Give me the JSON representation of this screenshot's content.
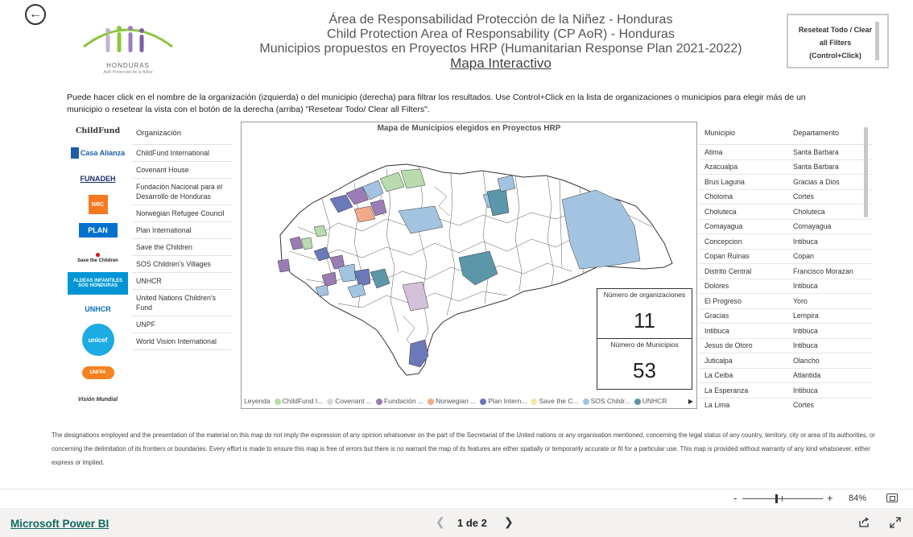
{
  "header": {
    "title_line1": "Área de Responsabilidad Protección de la Niñez - Honduras",
    "title_line2": "Child Protection Area of Responsability (CP AoR) - Honduras",
    "title_line3": "Municipios propuestos en Proyectos HRP (Humanitarian Response Plan 2021-2022)",
    "title_link": "Mapa Interactivo",
    "logo_name": "HONDURAS",
    "logo_subtitle": "AoR Protección de la Niñez",
    "reset_button": "Reseteat Todo / Clear all Filters (Control+Click)"
  },
  "instructions": "Puede hacer click en el nombre de la organización (izquierda) o del municipio (derecha) para filtrar los resultados. Use Control+Click en la lista de organizaciones o municipios para elegir más de un municipio o resetear la vista con el botón de la derecha (arriba) \"Resetear Todo/ Clear all Filters\".",
  "org_logos": [
    {
      "name": "ChildFund",
      "color": "#1a1a1a"
    },
    {
      "name": "Casa Alianza",
      "color": "#1a5fa8"
    },
    {
      "name": "FUNADEH",
      "color": "#1b2f6b"
    },
    {
      "name": "NRC",
      "color": "#f47920"
    },
    {
      "name": "PLAN",
      "color": "#0072ce"
    },
    {
      "name": "Save the Children",
      "color": "#d71920"
    },
    {
      "name": "ALDEAS INFANTILES SOS HONDURAS",
      "color": "#0096d6"
    },
    {
      "name": "UNHCR",
      "color": "#0072bc"
    },
    {
      "name": "unicef",
      "color": "#1cabe2"
    },
    {
      "name": "UNFPA",
      "color": "#f58220"
    },
    {
      "name": "Visión Mundial",
      "color": "#333333"
    }
  ],
  "organizations": {
    "header": "Organización",
    "items": [
      "ChildFund International",
      "Covenant House",
      "Fundación Nacional para el Desarrollo de Honduras",
      "Norwegian Refugee Council",
      "Plan International",
      "Save the Children",
      "SOS Children's Villages",
      "UNHCR",
      "United Nations Children's Fund",
      "UNPF",
      "World Vision International"
    ]
  },
  "map": {
    "title": "Mapa de Municipios elegidos en Proyectos HRP",
    "legend_label": "Leyenda",
    "legend": [
      {
        "name": "ChildFund I...",
        "color": "#b8dcae"
      },
      {
        "name": "Covenant ...",
        "color": "#d9d9d9"
      },
      {
        "name": "Fundación ...",
        "color": "#9a7db5"
      },
      {
        "name": "Norwegian ...",
        "color": "#f2a98a"
      },
      {
        "name": "Plan Intern...",
        "color": "#6b79b8"
      },
      {
        "name": "Save the C...",
        "color": "#f5e6a3"
      },
      {
        "name": "SOS Childr...",
        "color": "#a3c4e0"
      },
      {
        "name": "UNHCR",
        "color": "#5b97a8"
      }
    ]
  },
  "kpis": {
    "orgs_label": "Número de organizaciones",
    "orgs_value": "11",
    "munis_label": "Número de Municipios",
    "munis_value": "53"
  },
  "municipios": {
    "header_muni": "Municipio",
    "header_dept": "Departamento",
    "rows": [
      [
        "Atima",
        "Santa Barbara"
      ],
      [
        "Azacualpa",
        "Santa Barbara"
      ],
      [
        "Brus Laguna",
        "Gracias a Dios"
      ],
      [
        "Choloma",
        "Cortes"
      ],
      [
        "Choluteca",
        "Choluteca"
      ],
      [
        "Comayagua",
        "Comayagua"
      ],
      [
        "Concepcion",
        "Intibuca"
      ],
      [
        "Copan Ruinas",
        "Copan"
      ],
      [
        "Distrito Central",
        "Francisco Morazan"
      ],
      [
        "Dolores",
        "Intibuca"
      ],
      [
        "El Progreso",
        "Yoro"
      ],
      [
        "Gracias",
        "Lempira"
      ],
      [
        "Intibuca",
        "Intibuca"
      ],
      [
        "Jesus de Otoro",
        "Intibuca"
      ],
      [
        "Juticalpa",
        "Olancho"
      ],
      [
        "La Ceiba",
        "Atlantida"
      ],
      [
        "La Esperanza",
        "Intibuca"
      ],
      [
        "La Lima",
        "Cortes"
      ]
    ]
  },
  "disclaimer": "The designations employed and the presentation of the material on this map do not imply the expression of any opinion whatsoever on the part of the Secretariat of the United nations or any organisation mentioned, concerning the legal status of any country, territory, city or area of its authorities, or concerning the delimitation of its frontiers or boundaries. Every effort is made to ensure this map is free of errors but there is no warrant the map of its features are either spatially or temporarily accurate or fit for a particular use. This map is provided without warranty of any kind whatsoever, either express or implied.",
  "footer": {
    "zoom_minus": "-",
    "zoom_plus": "+",
    "zoom_level": "84%",
    "brand_link": "Microsoft Power BI",
    "page_indicator": "1 de 2"
  }
}
